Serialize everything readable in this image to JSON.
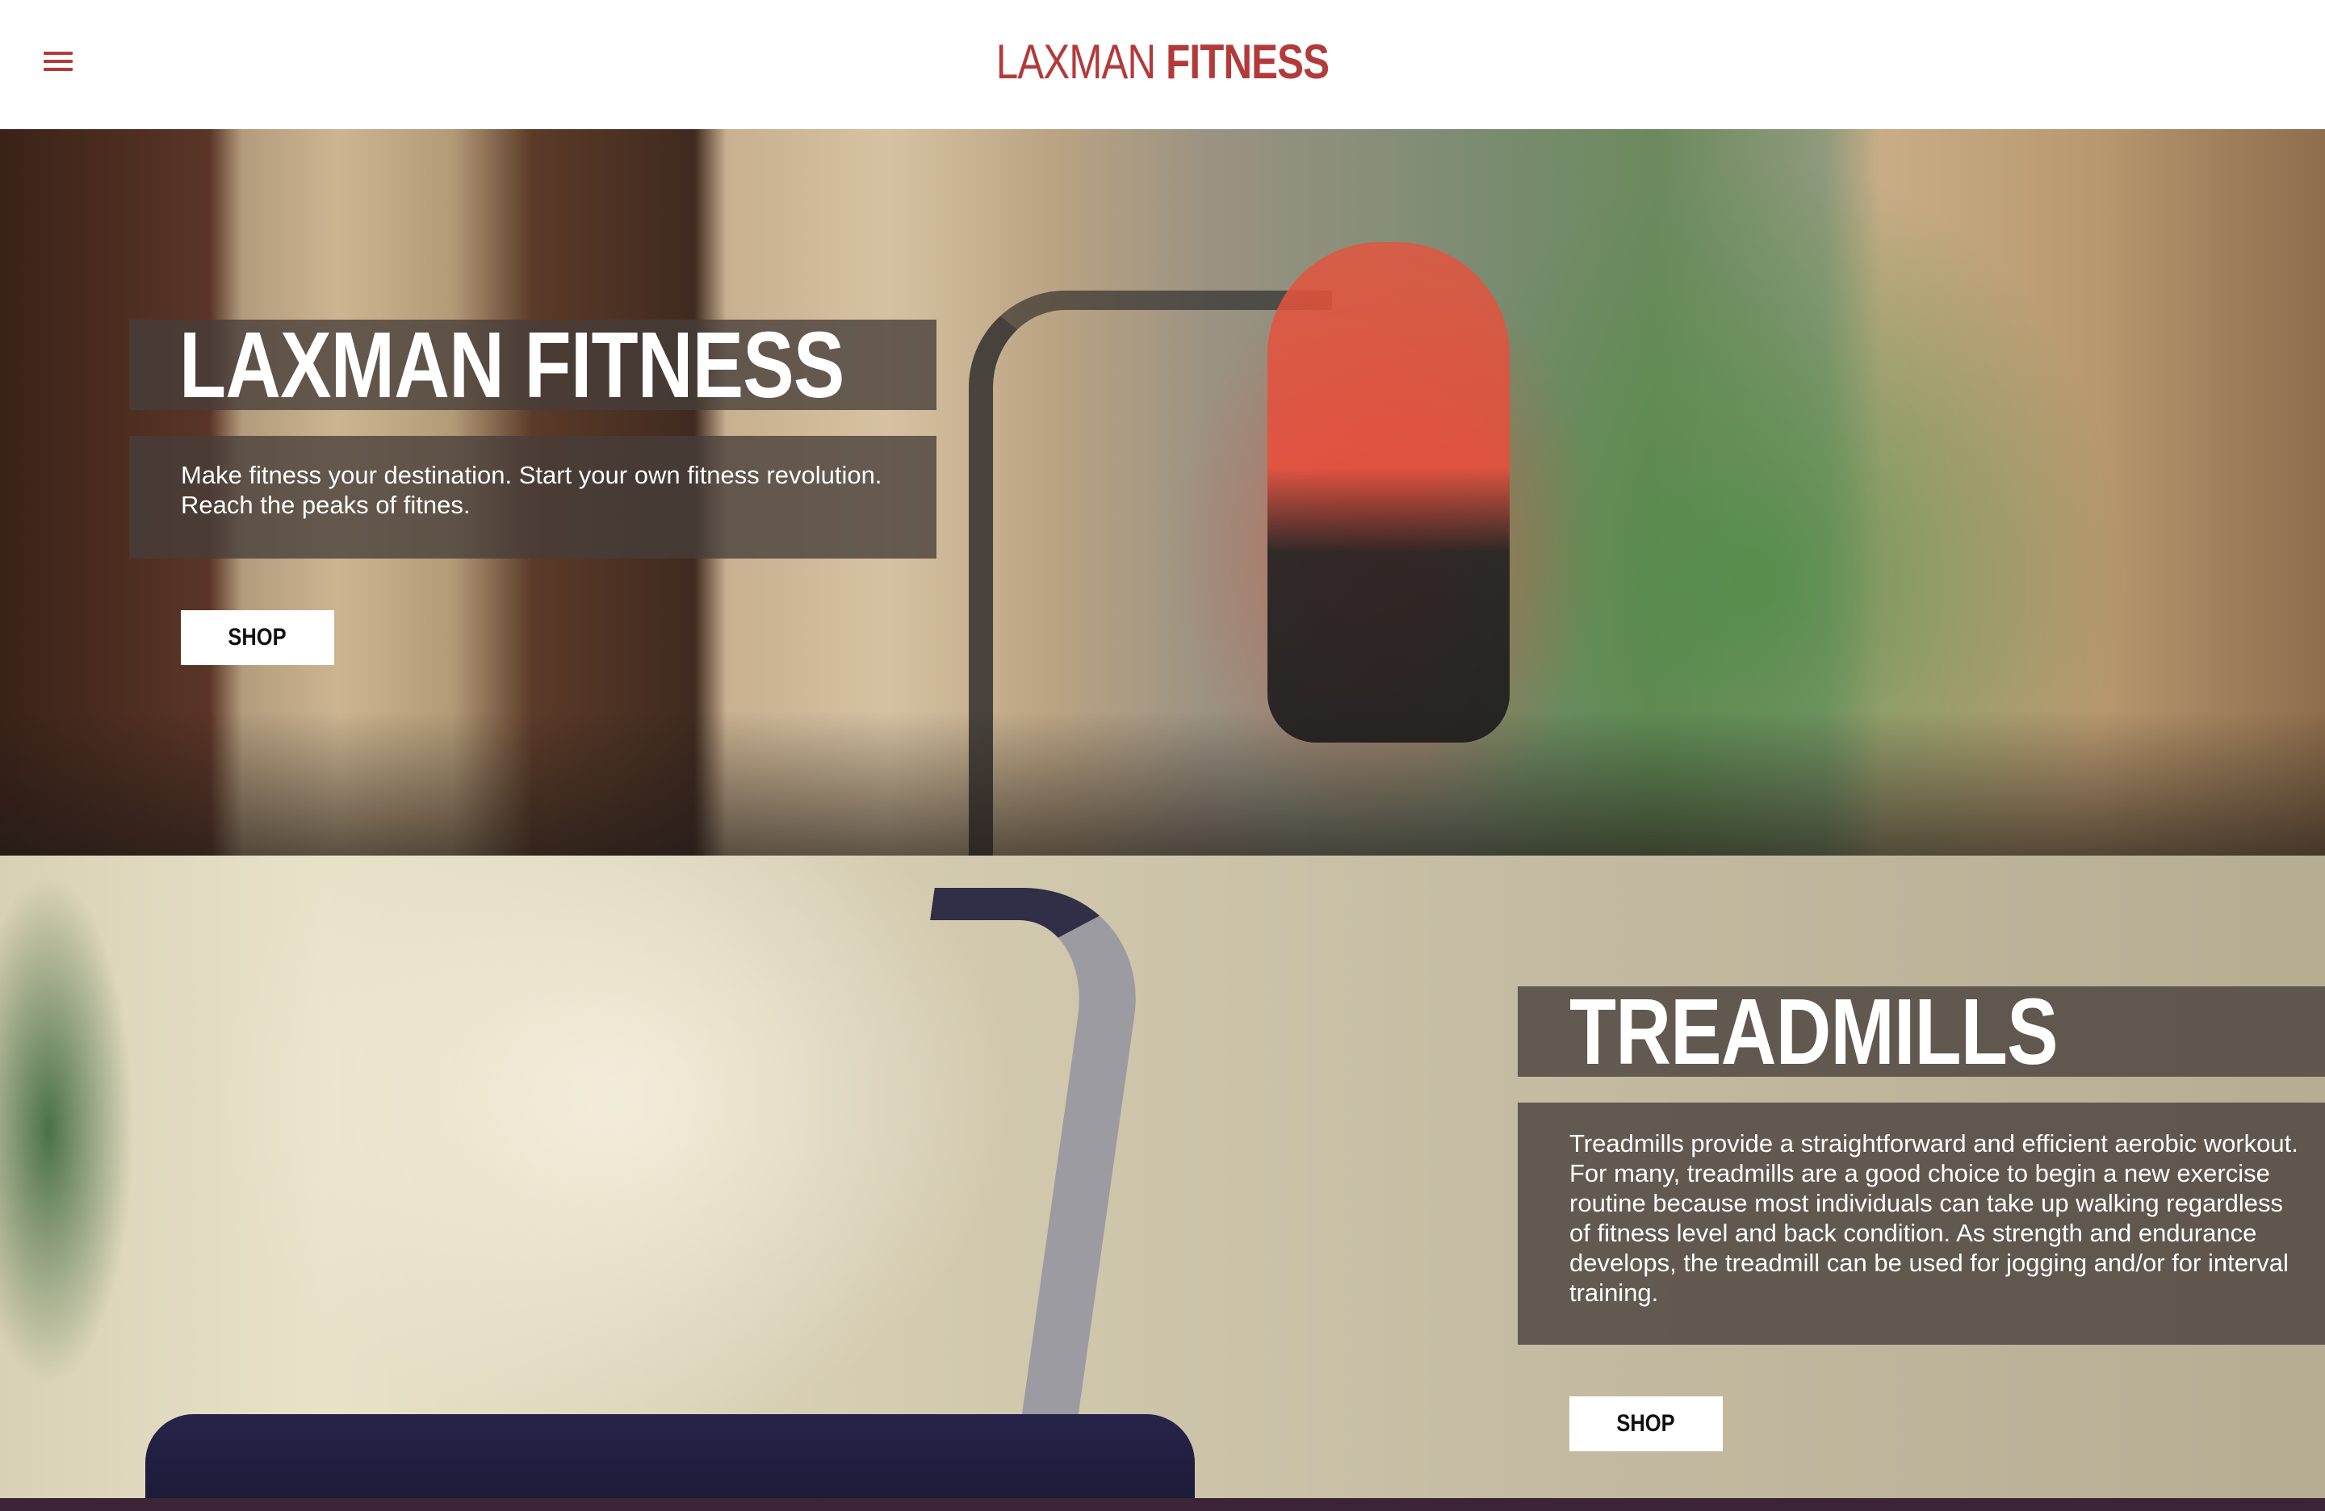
{
  "header": {
    "menu_icon": "hamburger-menu-icon",
    "logo_light": "LAXMAN",
    "logo_bold": "FITNESS",
    "accent_color": "#b33a3a"
  },
  "hero": {
    "title": "LAXMAN FITNESS",
    "text": "Make fitness your destination. Start your own fitness revolution. Reach the peaks of fitnes.",
    "shop_label": "SHOP"
  },
  "treadmills": {
    "title": "TREADMILLS",
    "text": "Treadmills provide a straightforward and efficient aerobic workout. For many, treadmills are a good choice to begin a new exercise routine because most individuals can take up walking regardless of fitness level and back condition. As strength and endurance develops, the treadmill can be used for jogging and/or for interval training.",
    "shop_label": "SHOP"
  }
}
